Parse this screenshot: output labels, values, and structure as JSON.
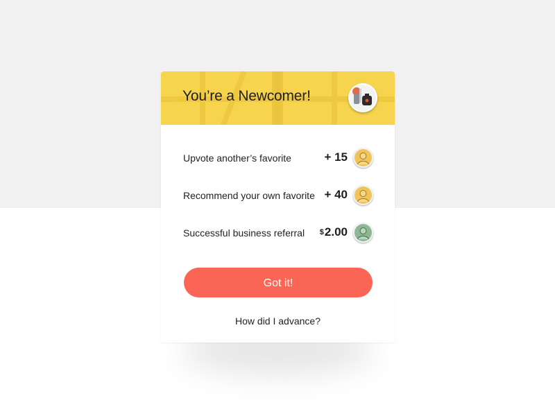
{
  "card": {
    "title": "You’re a Newcomer!",
    "header_color": "#f7d44e",
    "rewards": [
      {
        "label": "Upvote another’s favorite",
        "value": "+ 15",
        "currency": "",
        "icon": "gold-coin-icon"
      },
      {
        "label": "Recommend your own favorite",
        "value": "+ 40",
        "currency": "",
        "icon": "gold-coin-icon"
      },
      {
        "label": "Successful business referral",
        "value": "2.00",
        "currency": "$",
        "icon": "cash-coin-icon"
      }
    ],
    "cta_label": "Got it!",
    "cta_color": "#fb6555",
    "link_label": "How did I advance?"
  }
}
